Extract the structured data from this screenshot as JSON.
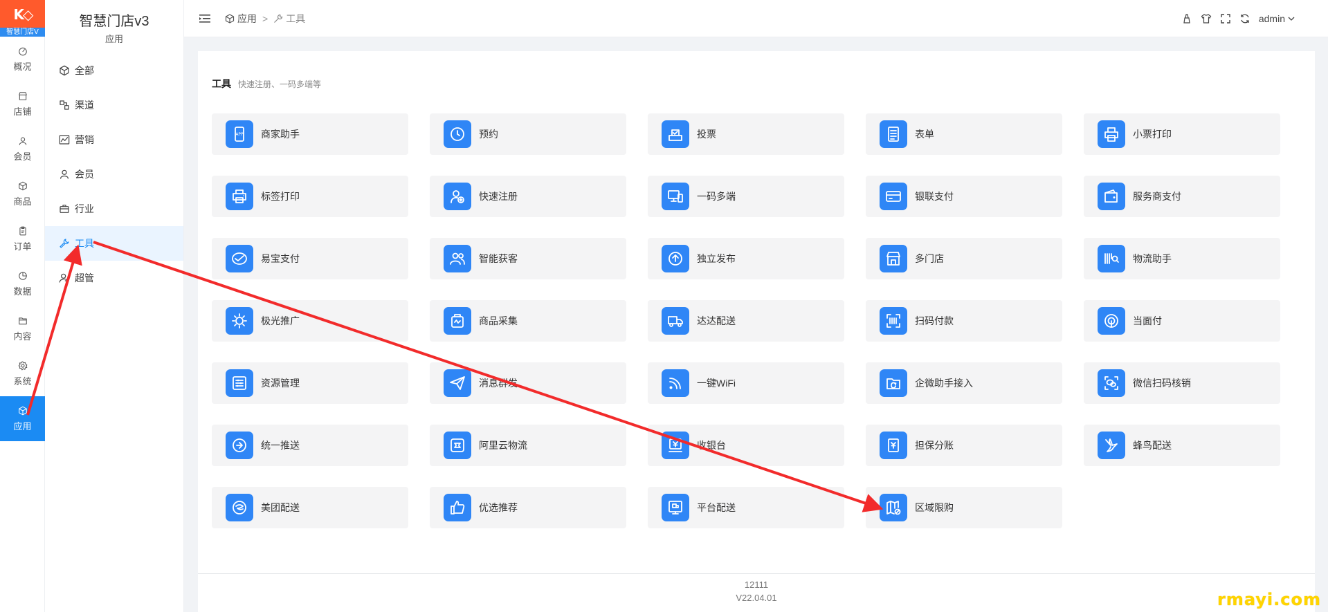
{
  "logo": {
    "text": "智慧门店V"
  },
  "rail": {
    "items": [
      {
        "label": "概况",
        "icon": "dashboard-icon"
      },
      {
        "label": "店铺",
        "icon": "store-icon"
      },
      {
        "label": "会员",
        "icon": "user-icon"
      },
      {
        "label": "商品",
        "icon": "box-icon"
      },
      {
        "label": "订单",
        "icon": "clipboard-icon"
      },
      {
        "label": "数据",
        "icon": "pie-chart-icon"
      },
      {
        "label": "内容",
        "icon": "folder-icon"
      },
      {
        "label": "系统",
        "icon": "gear-icon"
      },
      {
        "label": "应用",
        "icon": "cube-icon",
        "active": true
      }
    ]
  },
  "sidebar": {
    "title": "智慧门店v3",
    "caption": "应用",
    "items": [
      {
        "label": "全部",
        "icon": "cube-icon"
      },
      {
        "label": "渠道",
        "icon": "channel-icon"
      },
      {
        "label": "营销",
        "icon": "trend-icon"
      },
      {
        "label": "会员",
        "icon": "user-icon"
      },
      {
        "label": "行业",
        "icon": "briefcase-icon"
      },
      {
        "label": "工具",
        "icon": "wrench-icon",
        "active": true
      },
      {
        "label": "超管",
        "icon": "admin-icon"
      }
    ]
  },
  "header": {
    "breadcrumb": [
      "应用",
      "工具"
    ],
    "breadcrumb_sep": ">",
    "user": "admin"
  },
  "section": {
    "title": "工具",
    "subtitle": "快速注册、一码多端等"
  },
  "tools": [
    {
      "label": "商家助手",
      "icon": "app-phone-icon"
    },
    {
      "label": "预约",
      "icon": "clock-icon"
    },
    {
      "label": "投票",
      "icon": "vote-icon"
    },
    {
      "label": "表单",
      "icon": "form-icon"
    },
    {
      "label": "小票打印",
      "icon": "receipt-printer-icon"
    },
    {
      "label": "标签打印",
      "icon": "printer-icon"
    },
    {
      "label": "快速注册",
      "icon": "add-user-icon"
    },
    {
      "label": "一码多端",
      "icon": "devices-icon"
    },
    {
      "label": "银联支付",
      "icon": "card-icon"
    },
    {
      "label": "服务商支付",
      "icon": "wallet-icon"
    },
    {
      "label": "易宝支付",
      "icon": "yeepay-icon"
    },
    {
      "label": "智能获客",
      "icon": "users-icon"
    },
    {
      "label": "独立发布",
      "icon": "upload-icon"
    },
    {
      "label": "多门店",
      "icon": "shop-icon"
    },
    {
      "label": "物流助手",
      "icon": "barcode-search-icon"
    },
    {
      "label": "极光推广",
      "icon": "aurora-icon"
    },
    {
      "label": "商品采集",
      "icon": "collect-icon"
    },
    {
      "label": "达达配送",
      "icon": "truck-icon"
    },
    {
      "label": "扫码付款",
      "icon": "scan-icon"
    },
    {
      "label": "当面付",
      "icon": "face-pay-icon"
    },
    {
      "label": "资源管理",
      "icon": "sliders-icon"
    },
    {
      "label": "消息群发",
      "icon": "send-icon"
    },
    {
      "label": "一键WiFi",
      "icon": "wifi-icon"
    },
    {
      "label": "企微助手接入",
      "icon": "folder-sync-icon"
    },
    {
      "label": "微信扫码核销",
      "icon": "wechat-scan-icon"
    },
    {
      "label": "统一推送",
      "icon": "push-icon"
    },
    {
      "label": "阿里云物流",
      "icon": "cloud-logistics-icon"
    },
    {
      "label": "收银台",
      "icon": "cashier-icon"
    },
    {
      "label": "担保分账",
      "icon": "guarantee-icon"
    },
    {
      "label": "蜂鸟配送",
      "icon": "bird-icon"
    },
    {
      "label": "美团配送",
      "icon": "meituan-icon"
    },
    {
      "label": "优选推荐",
      "icon": "thumb-up-icon"
    },
    {
      "label": "平台配送",
      "icon": "platform-icon"
    },
    {
      "label": "区域限购",
      "icon": "map-limit-icon"
    }
  ],
  "footer": {
    "line1": "12111",
    "line2": "V22.04.01"
  },
  "watermark": "rmayi.com",
  "colors": {
    "accent": "#1b8bf3",
    "tile_icon": "#2f86f6",
    "annotation_arrow": "#f22b2b",
    "logo": "#ff5a2c"
  }
}
